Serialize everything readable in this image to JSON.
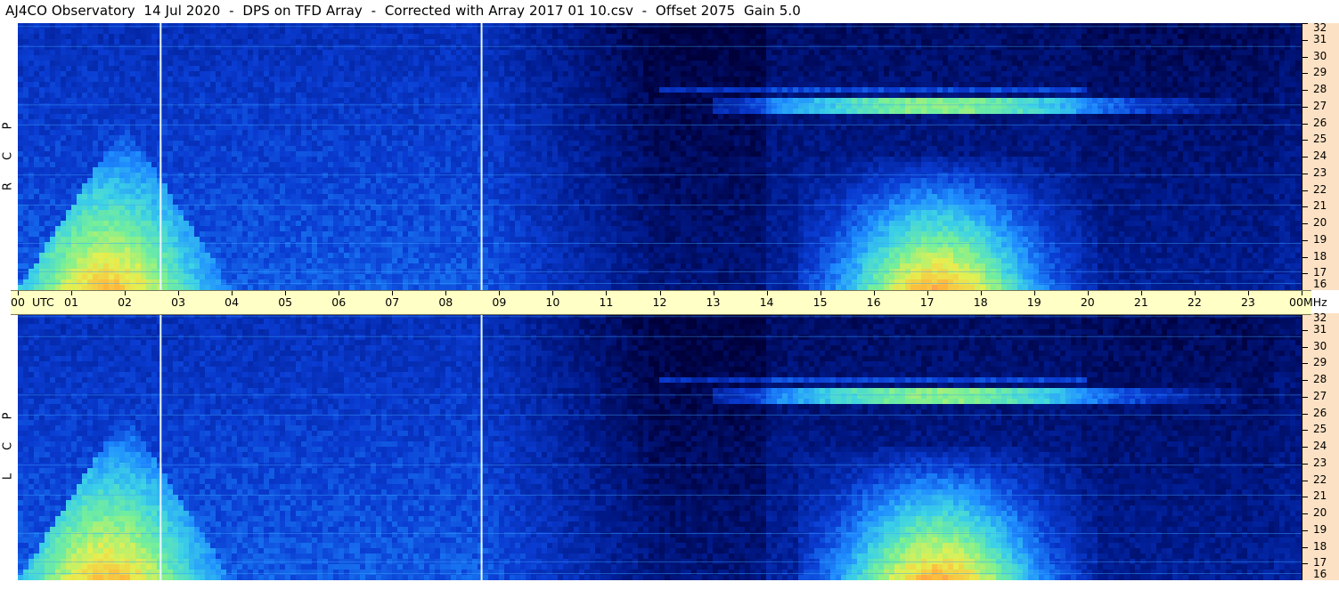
{
  "title": "AJ4CO Observatory  14 Jul 2020  -  DPS on TFD Array  -  Corrected with Array 2017 01 10.csv  -  Offset 2075  Gain 5.0",
  "chart_data": {
    "type": "heatmap",
    "title": "AJ4CO Observatory  14 Jul 2020  -  DPS on TFD Array  -  Corrected with Array 2017 01 10.csv  -  Offset 2075  Gain 5.0",
    "x_axis": {
      "unit_label": "UTC",
      "ticks": [
        "00",
        "01",
        "02",
        "03",
        "04",
        "05",
        "06",
        "07",
        "08",
        "09",
        "10",
        "11",
        "12",
        "13",
        "14",
        "15",
        "16",
        "17",
        "18",
        "19",
        "20",
        "21",
        "22",
        "23",
        "00"
      ],
      "range_hours": [
        0,
        24
      ]
    },
    "y_axis": {
      "unit_label": "MHz",
      "ticks": [
        "32",
        "31",
        "30",
        "29",
        "28",
        "27",
        "26",
        "25",
        "24",
        "23",
        "22",
        "21",
        "20",
        "19",
        "18",
        "17",
        "16"
      ],
      "range_mhz": [
        16,
        32
      ]
    },
    "panels": [
      {
        "name": "RCP",
        "letters": [
          "R",
          "C",
          "P"
        ]
      },
      {
        "name": "LCP",
        "letters": [
          "L",
          "C",
          "P"
        ]
      }
    ],
    "features": [
      {
        "desc": "morning broadband low-frequency enhancement",
        "time_utc": [
          0.0,
          2.6
        ],
        "freq_mhz": [
          16,
          26
        ]
      },
      {
        "desc": "daytime broadband enhancement",
        "time_utc": [
          14.8,
          19.8
        ],
        "freq_mhz": [
          16,
          24
        ]
      },
      {
        "desc": "intense band",
        "time_utc": [
          15.0,
          21.0
        ],
        "freq_mhz": [
          26.8,
          27.6
        ]
      },
      {
        "desc": "vertical marker",
        "time_utc": 2.67
      },
      {
        "desc": "vertical marker",
        "time_utc": 8.67
      }
    ],
    "colorscale": [
      "#00003a",
      "#001a8c",
      "#0a3cd2",
      "#1e8cff",
      "#3cd2e6",
      "#78f096",
      "#e6f050",
      "#ffb43c",
      "#ff50a0"
    ]
  }
}
